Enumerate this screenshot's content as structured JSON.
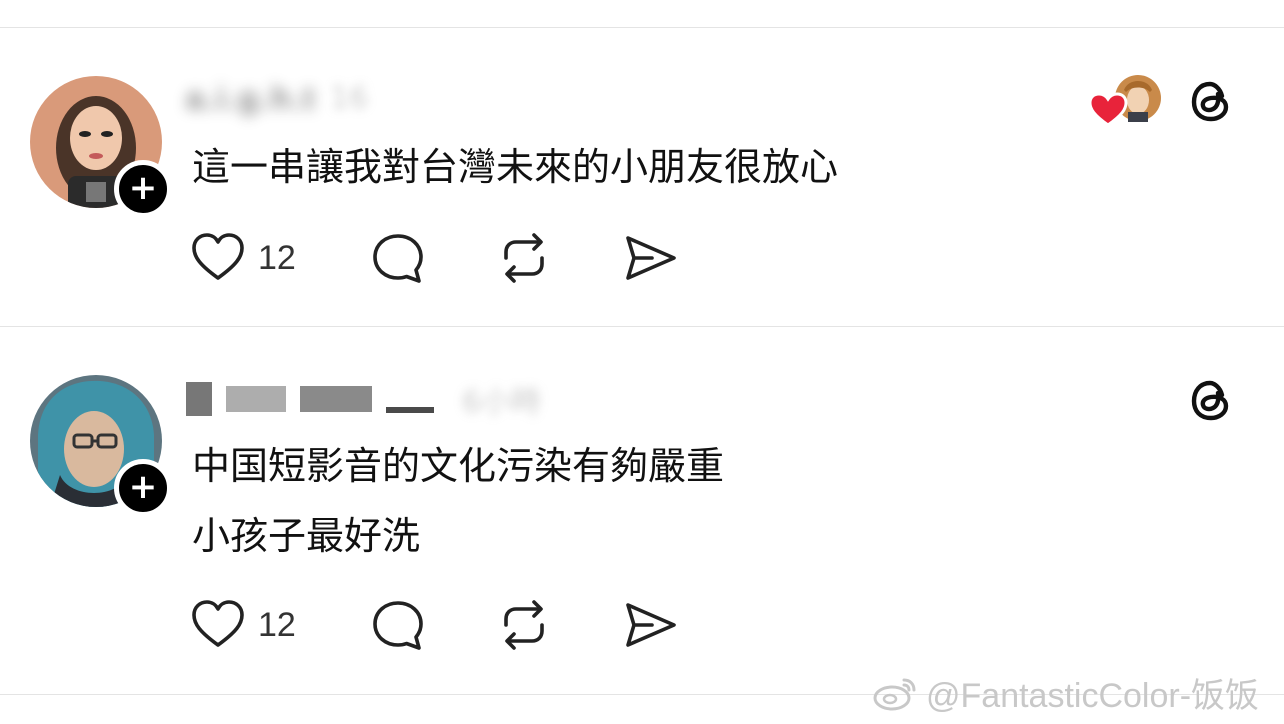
{
  "posts": [
    {
      "username": "a.i.g.h.t",
      "time": "16",
      "text_lines": [
        "這一串讓我對台灣未來的小朋友很放心"
      ],
      "like_count": "12",
      "has_liker_avatars": true
    },
    {
      "username": "",
      "time": "6小時",
      "text_lines": [
        "中国短影音的文化污染有夠嚴重",
        "小孩子最好洗"
      ],
      "like_count": "12",
      "has_liker_avatars": false
    }
  ],
  "icons": {
    "like": "heart-outline-icon",
    "reply": "speech-bubble-icon",
    "repost": "repost-arrows-icon",
    "share": "paper-plane-icon",
    "threads": "threads-logo-icon",
    "follow": "plus-icon",
    "liked": "heart-filled-icon"
  },
  "colors": {
    "text": "#111111",
    "divider": "#e4e4e4",
    "liked_heart": "#e8233a",
    "watermark": "#c8c8c8"
  },
  "watermark": {
    "text": "@FantasticColor-饭饭"
  }
}
